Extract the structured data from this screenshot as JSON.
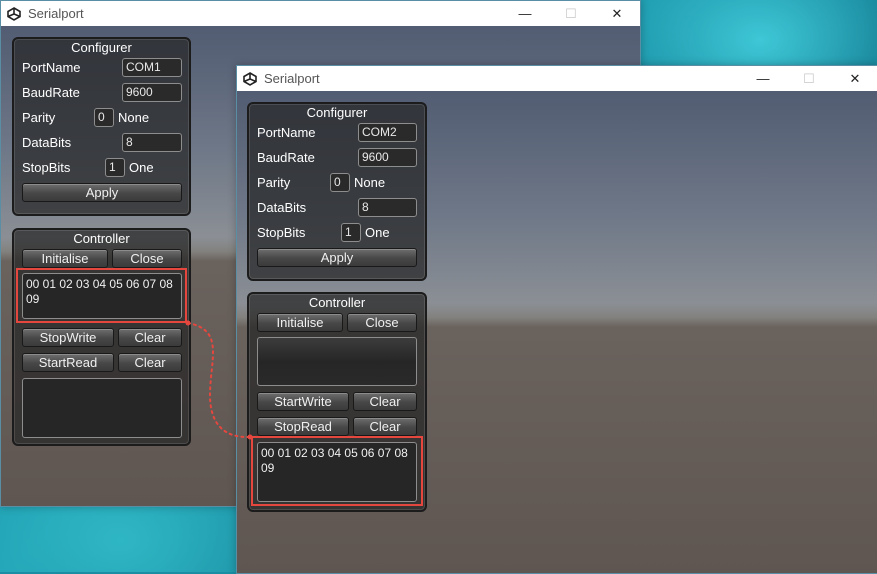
{
  "window1": {
    "title": "Serialport",
    "configurer": {
      "title": "Configurer",
      "port_name": {
        "label": "PortName",
        "value": "COM1"
      },
      "baud_rate": {
        "label": "BaudRate",
        "value": "9600"
      },
      "parity": {
        "label": "Parity",
        "value": "0",
        "text": "None"
      },
      "data_bits": {
        "label": "DataBits",
        "value": "8"
      },
      "stop_bits": {
        "label": "StopBits",
        "value": "1",
        "text": "One"
      },
      "apply": "Apply"
    },
    "controller": {
      "title": "Controller",
      "initialise": "Initialise",
      "close": "Close",
      "write_text": "00 01 02 03 04 05 06 07 08 09",
      "write_toggle": "StopWrite",
      "clear_write": "Clear",
      "read_toggle": "StartRead",
      "clear_read": "Clear",
      "read_text": ""
    }
  },
  "window2": {
    "title": "Serialport",
    "configurer": {
      "title": "Configurer",
      "port_name": {
        "label": "PortName",
        "value": "COM2"
      },
      "baud_rate": {
        "label": "BaudRate",
        "value": "9600"
      },
      "parity": {
        "label": "Parity",
        "value": "0",
        "text": "None"
      },
      "data_bits": {
        "label": "DataBits",
        "value": "8"
      },
      "stop_bits": {
        "label": "StopBits",
        "value": "1",
        "text": "One"
      },
      "apply": "Apply"
    },
    "controller": {
      "title": "Controller",
      "initialise": "Initialise",
      "close": "Close",
      "write_text": "",
      "write_toggle": "StartWrite",
      "clear_write": "Clear",
      "read_toggle": "StopRead",
      "clear_read": "Clear",
      "read_text": "00 01 02 03 04 05 06 07 08 09"
    }
  },
  "window_controls": {
    "minimize": "—",
    "maximize": "☐",
    "close": "✕"
  },
  "colors": {
    "highlight": "#e5473f",
    "desktop": "#1a8fa3"
  }
}
